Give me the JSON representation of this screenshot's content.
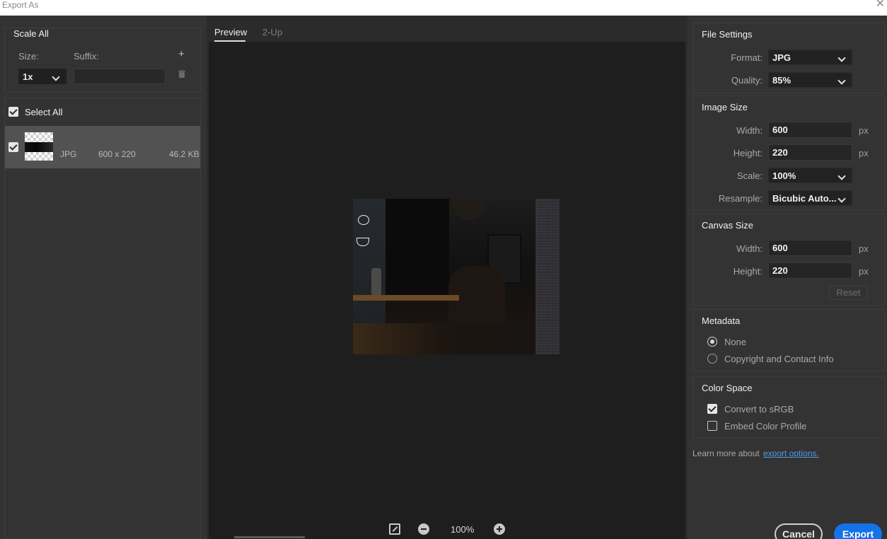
{
  "window": {
    "title": "Export As"
  },
  "left": {
    "scale_title": "Scale All",
    "size_label": "Size:",
    "suffix_label": "Suffix:",
    "size_value": "1x",
    "suffix_value": "",
    "add_icon": "plus-icon",
    "delete_icon": "trash-icon",
    "select_all_label": "Select All",
    "select_all_checked": true,
    "items": [
      {
        "checked": true,
        "format": "JPG",
        "dimensions": "600 x 220",
        "size": "46.2 KB"
      }
    ]
  },
  "center": {
    "tabs": [
      {
        "label": "Preview",
        "active": true
      },
      {
        "label": "2-Up",
        "active": false
      }
    ],
    "zoom": "100%"
  },
  "right": {
    "file_settings": {
      "title": "File Settings",
      "format_label": "Format:",
      "format_value": "JPG",
      "quality_label": "Quality:",
      "quality_value": "85%"
    },
    "image_size": {
      "title": "Image Size",
      "width_label": "Width:",
      "width_value": "600",
      "height_label": "Height:",
      "height_value": "220",
      "scale_label": "Scale:",
      "scale_value": "100%",
      "resample_label": "Resample:",
      "resample_value": "Bicubic Auto...",
      "unit": "px"
    },
    "canvas_size": {
      "title": "Canvas Size",
      "width_label": "Width:",
      "width_value": "600",
      "height_label": "Height:",
      "height_value": "220",
      "unit": "px",
      "reset_label": "Reset"
    },
    "metadata": {
      "title": "Metadata",
      "options": [
        {
          "label": "None",
          "selected": true
        },
        {
          "label": "Copyright and Contact Info",
          "selected": false
        }
      ]
    },
    "color_space": {
      "title": "Color Space",
      "options": [
        {
          "label": "Convert to sRGB",
          "checked": true
        },
        {
          "label": "Embed Color Profile",
          "checked": false
        }
      ]
    },
    "learn_more_text": "Learn more about",
    "learn_more_link": "export options.",
    "cancel_label": "Cancel",
    "export_label": "Export"
  },
  "colors": {
    "accent": "#1473e6",
    "link": "#4e9ce6",
    "panel": "#333333",
    "canvas": "#1e1e1e"
  }
}
